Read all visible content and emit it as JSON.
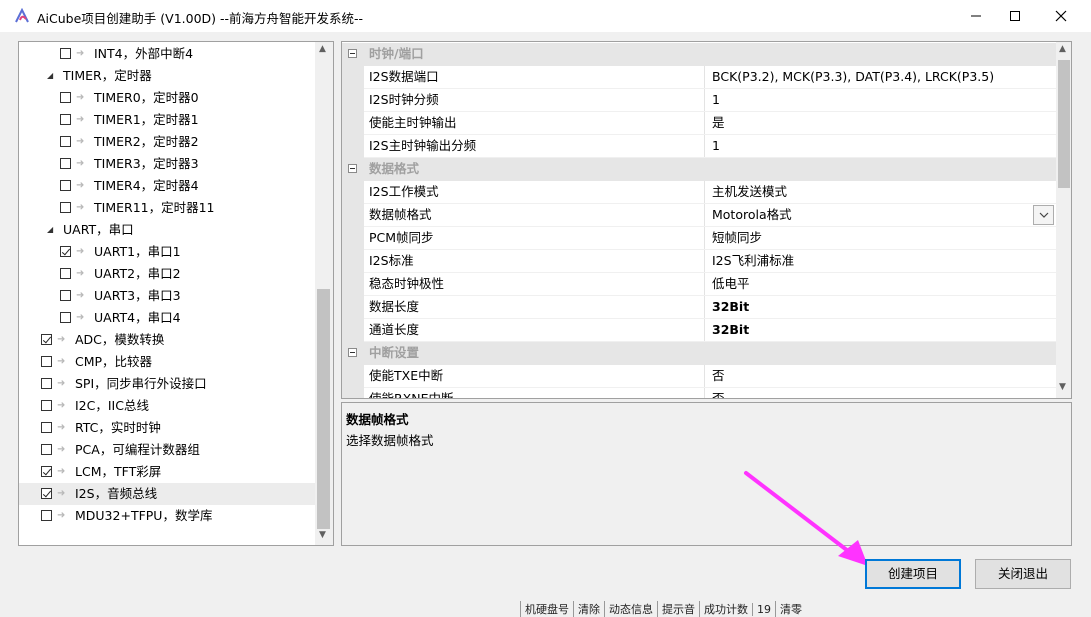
{
  "window": {
    "title": "AiCube项目创建助手 (V1.00D) --前海方舟智能开发系统--"
  },
  "tree": {
    "rows": [
      {
        "label": "INT4，外部中断4",
        "level": 2,
        "checkbox": true,
        "checked": false,
        "expand": false
      },
      {
        "label": "TIMER，定时器",
        "level": 1,
        "checkbox": false,
        "checked": false,
        "expand": true
      },
      {
        "label": "TIMER0，定时器0",
        "level": 2,
        "checkbox": true,
        "checked": false,
        "expand": false
      },
      {
        "label": "TIMER1，定时器1",
        "level": 2,
        "checkbox": true,
        "checked": false,
        "expand": false
      },
      {
        "label": "TIMER2，定时器2",
        "level": 2,
        "checkbox": true,
        "checked": false,
        "expand": false
      },
      {
        "label": "TIMER3，定时器3",
        "level": 2,
        "checkbox": true,
        "checked": false,
        "expand": false
      },
      {
        "label": "TIMER4，定时器4",
        "level": 2,
        "checkbox": true,
        "checked": false,
        "expand": false
      },
      {
        "label": "TIMER11，定时器11",
        "level": 2,
        "checkbox": true,
        "checked": false,
        "expand": false
      },
      {
        "label": "UART，串口",
        "level": 1,
        "checkbox": false,
        "checked": false,
        "expand": true
      },
      {
        "label": "UART1，串口1",
        "level": 2,
        "checkbox": true,
        "checked": true,
        "expand": false
      },
      {
        "label": "UART2，串口2",
        "level": 2,
        "checkbox": true,
        "checked": false,
        "expand": false
      },
      {
        "label": "UART3，串口3",
        "level": 2,
        "checkbox": true,
        "checked": false,
        "expand": false
      },
      {
        "label": "UART4，串口4",
        "level": 2,
        "checkbox": true,
        "checked": false,
        "expand": false
      },
      {
        "label": "ADC，模数转换",
        "level": 0,
        "checkbox": true,
        "checked": true,
        "expand": false
      },
      {
        "label": "CMP，比较器",
        "level": 0,
        "checkbox": true,
        "checked": false,
        "expand": false
      },
      {
        "label": "SPI，同步串行外设接口",
        "level": 0,
        "checkbox": true,
        "checked": false,
        "expand": false
      },
      {
        "label": "I2C，IIC总线",
        "level": 0,
        "checkbox": true,
        "checked": false,
        "expand": false
      },
      {
        "label": "RTC，实时时钟",
        "level": 0,
        "checkbox": true,
        "checked": false,
        "expand": false
      },
      {
        "label": "PCA，可编程计数器组",
        "level": 0,
        "checkbox": true,
        "checked": false,
        "expand": false
      },
      {
        "label": "LCM，TFT彩屏",
        "level": 0,
        "checkbox": true,
        "checked": true,
        "expand": false
      },
      {
        "label": "I2S，音频总线",
        "level": 0,
        "checkbox": true,
        "checked": true,
        "expand": false,
        "selected": true
      },
      {
        "label": "MDU32+TFPU，数学库",
        "level": 0,
        "checkbox": true,
        "checked": false,
        "expand": false
      }
    ]
  },
  "grid": {
    "rows": [
      {
        "type": "category",
        "label": "时钟/端口"
      },
      {
        "type": "prop",
        "name": "I2S数据端口",
        "value": "BCK(P3.2), MCK(P3.3), DAT(P3.4), LRCK(P3.5)"
      },
      {
        "type": "prop",
        "name": "I2S时钟分频",
        "value": "1"
      },
      {
        "type": "prop",
        "name": "使能主时钟输出",
        "value": "是"
      },
      {
        "type": "prop",
        "name": "I2S主时钟输出分频",
        "value": "1"
      },
      {
        "type": "category",
        "label": "数据格式"
      },
      {
        "type": "prop",
        "name": "I2S工作模式",
        "value": "主机发送模式"
      },
      {
        "type": "prop",
        "name": "数据帧格式",
        "value": "Motorola格式",
        "dropdown": true,
        "selected": true
      },
      {
        "type": "prop",
        "name": "PCM帧同步",
        "value": "短帧同步"
      },
      {
        "type": "prop",
        "name": "I2S标准",
        "value": "I2S飞利浦标准"
      },
      {
        "type": "prop",
        "name": "稳态时钟极性",
        "value": "低电平"
      },
      {
        "type": "prop",
        "name": "数据长度",
        "value": "32Bit",
        "bold": true
      },
      {
        "type": "prop",
        "name": "通道长度",
        "value": "32Bit",
        "bold": true
      },
      {
        "type": "category",
        "label": "中断设置"
      },
      {
        "type": "prop",
        "name": "使能TXE中断",
        "value": "否"
      },
      {
        "type": "prop",
        "name": "使能RXNE中断",
        "value": "否"
      }
    ]
  },
  "description": {
    "title": "数据帧格式",
    "text": "选择数据帧格式"
  },
  "buttons": {
    "create": "创建项目",
    "close": "关闭退出"
  },
  "statusbar": [
    "机硬盘号",
    "清除",
    "动态信息",
    "提示音",
    "成功计数",
    "19",
    "清零"
  ],
  "colors": {
    "accent": "#0078d7",
    "annotation_arrow": "#ff33ff"
  }
}
